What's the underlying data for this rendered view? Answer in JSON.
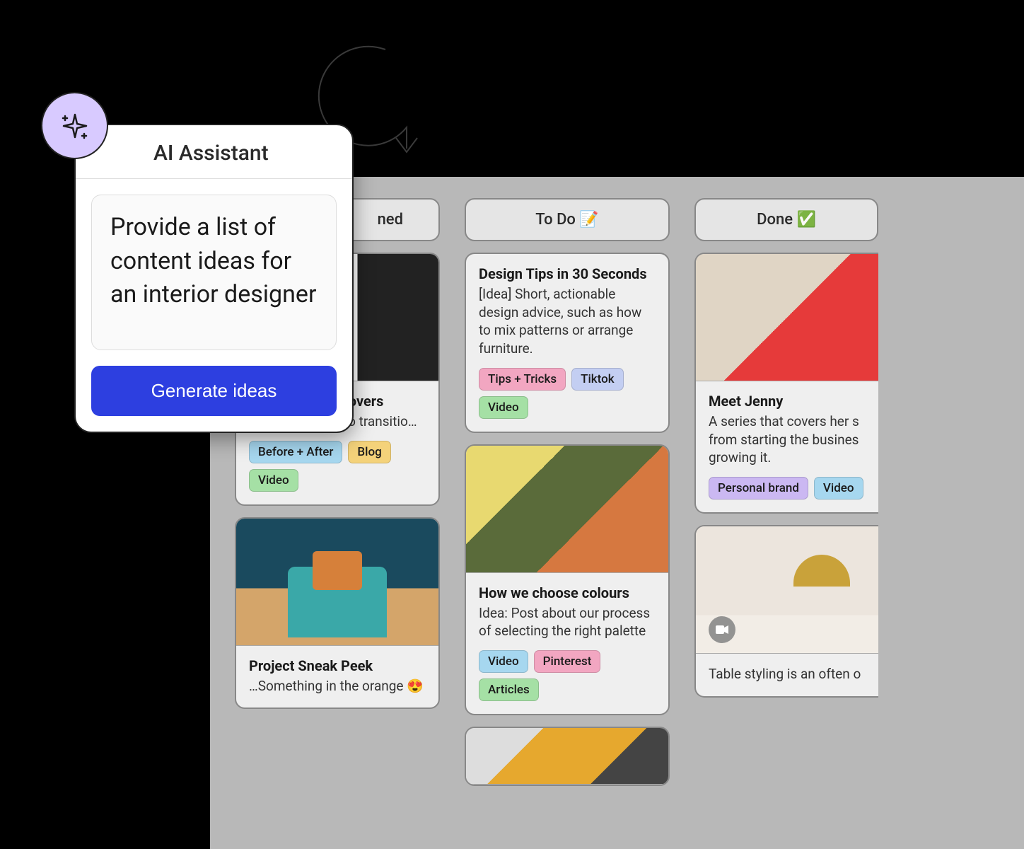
{
  "ai": {
    "title": "AI Assistant",
    "prompt": "Provide a list of content ideas for an interior designer ",
    "button": "Generate ideas"
  },
  "columns": [
    {
      "label": "Planned",
      "partial": "ned"
    },
    {
      "label": "To Do 📝"
    },
    {
      "label": "Done ✅"
    }
  ],
  "tagColors": {
    "Before + After": "#a6d7ef",
    "Blog": "#f4d27a",
    "Video": "#a5e0a5",
    "Tips + Tricks": "#f2a6c1",
    "Tiktok": "#c3cef2",
    "Pinterest": "#f2a6c1",
    "Articles": "#a5e0a5",
    "Personal brand": "#cbb8f2"
  },
  "cards": {
    "planned": [
      {
        "title": "Room Makeovers",
        "titleVisible": "eovers",
        "desc": "Before-and-after video transitio…",
        "descVisible": "eo transitio…",
        "tags": [
          "Before + After",
          "Blog",
          "Video"
        ],
        "image": "swatches"
      },
      {
        "title": "Project Sneak Peek",
        "desc": "…Something in the orange 😍",
        "tags": [],
        "image": "chair"
      }
    ],
    "todo": [
      {
        "title": "Design Tips in 30 Seconds",
        "desc": "[Idea] Short, actionable design advice, such as how to mix patterns or arrange furniture.",
        "tags": [
          "Tips + Tricks",
          "Tiktok",
          "Video"
        ]
      },
      {
        "title": "How we choose colours",
        "desc": "Idea: Post about our process of selecting the right palette",
        "tags": [
          "Video",
          "Pinterest",
          "Articles"
        ],
        "image": "palette"
      },
      {
        "image": "book"
      }
    ],
    "done": [
      {
        "title": "Meet Jenny",
        "desc": "A series that covers her s\nfrom starting the busines\ngrowing it.",
        "tags": [
          "Personal brand",
          "Video"
        ],
        "image": "jenny"
      },
      {
        "desc": "Table styling is an often o",
        "image": "lamp",
        "hasVideoBadge": true
      }
    ]
  }
}
